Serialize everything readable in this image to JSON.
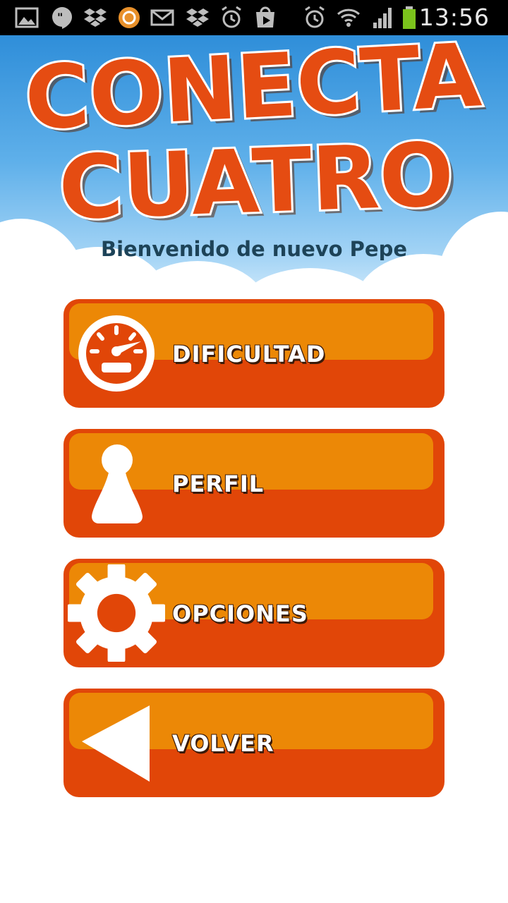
{
  "status_bar": {
    "time": "13:56",
    "icons": [
      "gallery-icon",
      "hangouts-icon",
      "dropbox-icon",
      "avast-icon",
      "mail-icon",
      "dropbox-icon",
      "alarm-icon",
      "play-store-icon",
      "alarm-clock-icon",
      "wifi-icon",
      "signal-icon",
      "battery-icon"
    ]
  },
  "app": {
    "title_line1": "CONECTA",
    "title_line2": "CUATRO",
    "welcome": "Bienvenido de nuevo Pepe"
  },
  "menu": {
    "items": [
      {
        "label": "DIFICULTAD",
        "icon": "speedometer-icon"
      },
      {
        "label": "PERFIL",
        "icon": "user-icon"
      },
      {
        "label": "OPCIONES",
        "icon": "gear-icon"
      },
      {
        "label": "VOLVER",
        "icon": "back-arrow-icon"
      }
    ]
  },
  "colors": {
    "button_base": "#e14608",
    "button_highlight": "#ec8806",
    "title": "#e54c12",
    "welcome_text": "#1d4358"
  }
}
